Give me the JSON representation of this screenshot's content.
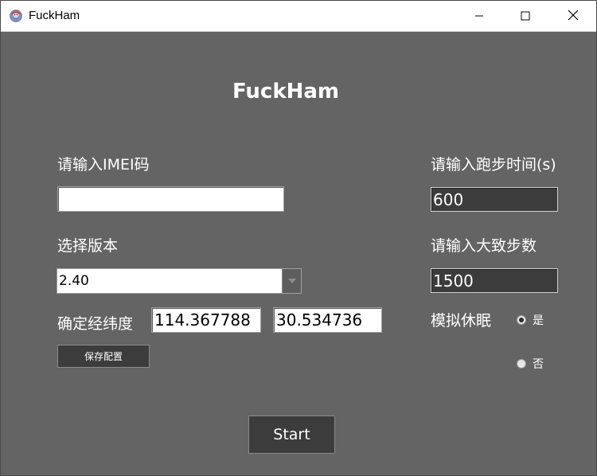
{
  "window": {
    "title": "FuckHam"
  },
  "heading": "FuckHam",
  "imei": {
    "label": "请输入IMEI码",
    "value": ""
  },
  "run_time": {
    "label": "请输入跑步时间(s)",
    "value": "600"
  },
  "version": {
    "label": "选择版本",
    "selected": "2.40"
  },
  "steps": {
    "label": "请输入大致步数",
    "value": "1500"
  },
  "coords": {
    "label": "确定经纬度",
    "longitude": "114.367788",
    "latitude": "30.534736"
  },
  "sleep": {
    "label": "模拟休眠",
    "options": [
      {
        "label": "是",
        "checked": true
      },
      {
        "label": "否",
        "checked": false
      }
    ]
  },
  "buttons": {
    "save_config": "保存配置",
    "start": "Start"
  },
  "icons": {
    "app": "app-icon",
    "minimize": "minimize-icon",
    "maximize": "maximize-icon",
    "close": "close-icon",
    "dropdown": "chevron-down-icon"
  }
}
